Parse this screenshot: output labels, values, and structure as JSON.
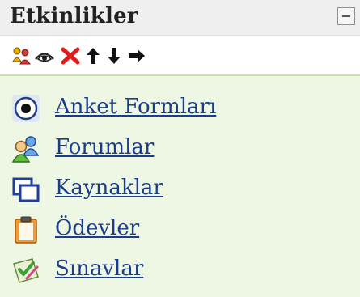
{
  "block": {
    "title": "Etkinlikler"
  },
  "toolbar": {
    "icons": [
      "roles-icon",
      "eye-icon",
      "delete-icon",
      "move-up-icon",
      "move-down-icon",
      "move-right-icon"
    ]
  },
  "activities": [
    {
      "label": "Anket Formları",
      "icon": "choice-icon"
    },
    {
      "label": "Forumlar",
      "icon": "forum-icon"
    },
    {
      "label": "Kaynaklar",
      "icon": "resource-icon"
    },
    {
      "label": "Ödevler",
      "icon": "assignment-icon"
    },
    {
      "label": "Sınavlar",
      "icon": "quiz-icon"
    }
  ],
  "colors": {
    "header_bg": "#efefef",
    "content_bg": "#eef7e3",
    "link": "#1a3c8c"
  }
}
